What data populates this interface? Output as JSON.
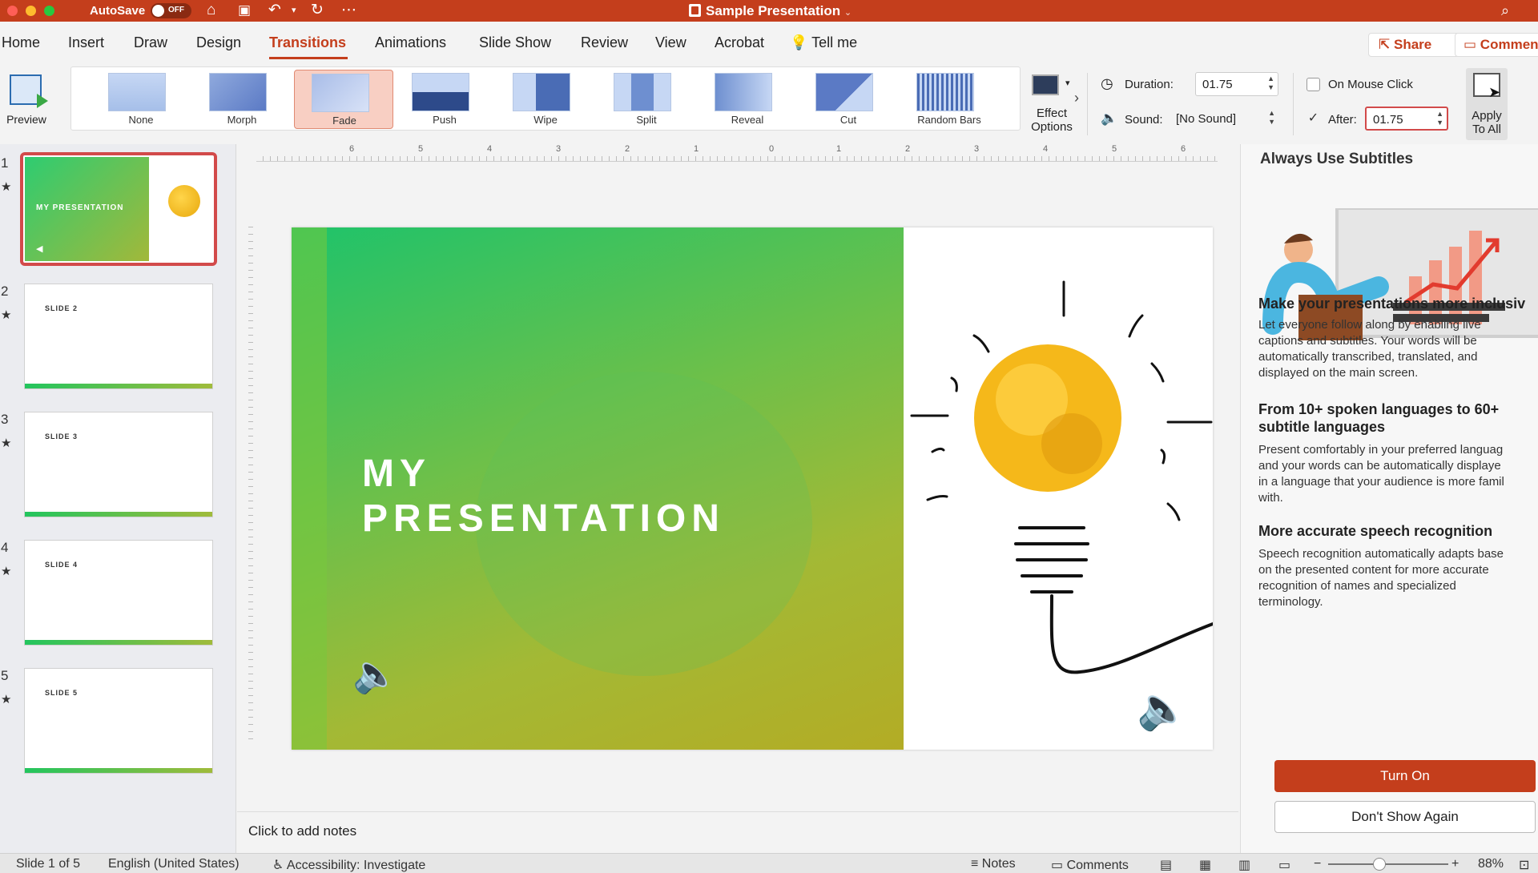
{
  "titlebar": {
    "autosave_label": "AutoSave",
    "autosave_state": "OFF",
    "doc_title": "Sample Presentation",
    "icons": [
      "home-icon",
      "save-icon",
      "undo-icon",
      "redo-icon",
      "more-icon",
      "search-icon"
    ]
  },
  "ribbon_tabs": [
    {
      "label": "Home"
    },
    {
      "label": "Insert"
    },
    {
      "label": "Draw"
    },
    {
      "label": "Design"
    },
    {
      "label": "Transitions",
      "active": true
    },
    {
      "label": "Animations"
    },
    {
      "label": "Slide Show"
    },
    {
      "label": "Review"
    },
    {
      "label": "View"
    },
    {
      "label": "Acrobat"
    },
    {
      "label": "Tell me"
    }
  ],
  "share_label": "Share",
  "comments_label": "Commen",
  "ribbon": {
    "preview_label": "Preview",
    "transitions": [
      {
        "label": "None"
      },
      {
        "label": "Morph"
      },
      {
        "label": "Fade",
        "selected": true
      },
      {
        "label": "Push"
      },
      {
        "label": "Wipe"
      },
      {
        "label": "Split"
      },
      {
        "label": "Reveal"
      },
      {
        "label": "Cut"
      },
      {
        "label": "Random Bars"
      }
    ],
    "effect_options_label": "Effect\nOptions",
    "duration_label": "Duration:",
    "duration_value": "01.75",
    "sound_label": "Sound:",
    "sound_value": "[No Sound]",
    "on_mouse_click_label": "On Mouse Click",
    "after_label": "After:",
    "after_value": "01.75",
    "apply_all_label": "Apply\nTo All"
  },
  "slides": [
    {
      "num": "1",
      "title": "MY PRESENTATION",
      "selected": true
    },
    {
      "num": "2",
      "title": "SLIDE 2"
    },
    {
      "num": "3",
      "title": "SLIDE 3"
    },
    {
      "num": "4",
      "title": "SLIDE 4"
    },
    {
      "num": "5",
      "title": "SLIDE 5"
    }
  ],
  "slide_main": {
    "title": "MY\nPRESENTATION"
  },
  "ruler_numbers": [
    "6",
    "5",
    "4",
    "3",
    "2",
    "1",
    "0",
    "1",
    "2",
    "3",
    "4",
    "5",
    "6"
  ],
  "notes_placeholder": "Click to add notes",
  "pane": {
    "title": "Always Use Subtitles",
    "h1": "Make your presentations more inclusiv",
    "p1": "Let everyone follow along by enabling live\ncaptions and subtitles. Your words will be\nautomatically transcribed, translated, and\ndisplayed on the main screen.",
    "h2": "From 10+ spoken languages to 60+\nsubtitle languages",
    "p2": "Present comfortably in your preferred languag\nand your words can be automatically displaye\nin a language that your audience is more famil\nwith.",
    "h3": "More accurate speech recognition",
    "p3": "Speech recognition automatically adapts base\non the presented content for more accurate\nrecognition of names and specialized\nterminology.",
    "turn_on_label": "Turn On",
    "dont_show_label": "Don't Show Again"
  },
  "status": {
    "slide_count": "Slide 1 of 5",
    "language": "English (United States)",
    "accessibility": "Accessibility: Investigate",
    "notes_label": "Notes",
    "comments_label": "Comments",
    "zoom": "88%"
  },
  "colors": {
    "accent": "#c43e1c",
    "slide_green": "#1fc36a",
    "slide_olive": "#b3ac25"
  }
}
